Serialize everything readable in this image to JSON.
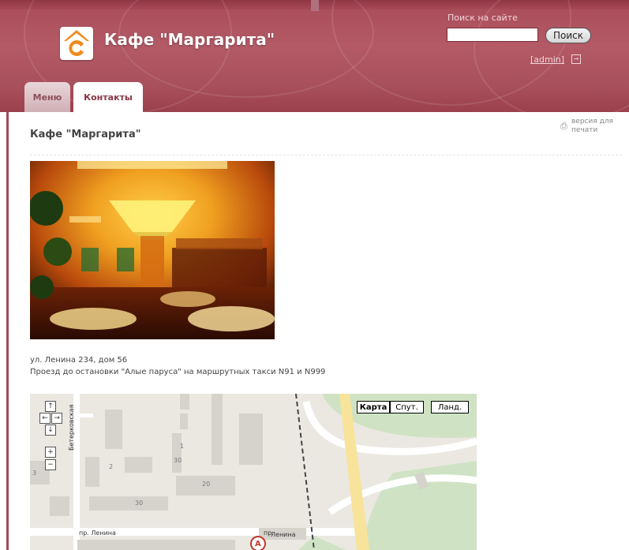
{
  "header": {
    "site_title": "Кафе \"Маргарита\"",
    "search_label": "Поиск на сайте",
    "search_value": "",
    "search_button": "Поиск",
    "admin_link": "[admin]"
  },
  "tabs": [
    {
      "label": "Меню",
      "active": false
    },
    {
      "label": "Контакты",
      "active": true
    }
  ],
  "main": {
    "title": "Кафе \"Маргарита\"",
    "print_link": "версия для печати",
    "address": "ул. Ленина 234, дом 56",
    "directions": "Проезд до остановки \"Алые паруса\" на маршрутных такси N91 и N999"
  },
  "map": {
    "types": [
      "Карта",
      "Спут.",
      "Ланд."
    ],
    "selected_type": "Карта",
    "street_labels": {
      "vertical": "Бетерковская",
      "bottom_left": "пр. Ленина",
      "bottom_right": "Ленина",
      "near": "пр."
    },
    "house_numbers": [
      "1",
      "2",
      "3",
      "30",
      "20",
      "30"
    ],
    "marker": "A"
  },
  "colors": {
    "header": "#a94b59",
    "tab_active_text": "#8a3443",
    "logo_orange": "#f08a1c"
  }
}
